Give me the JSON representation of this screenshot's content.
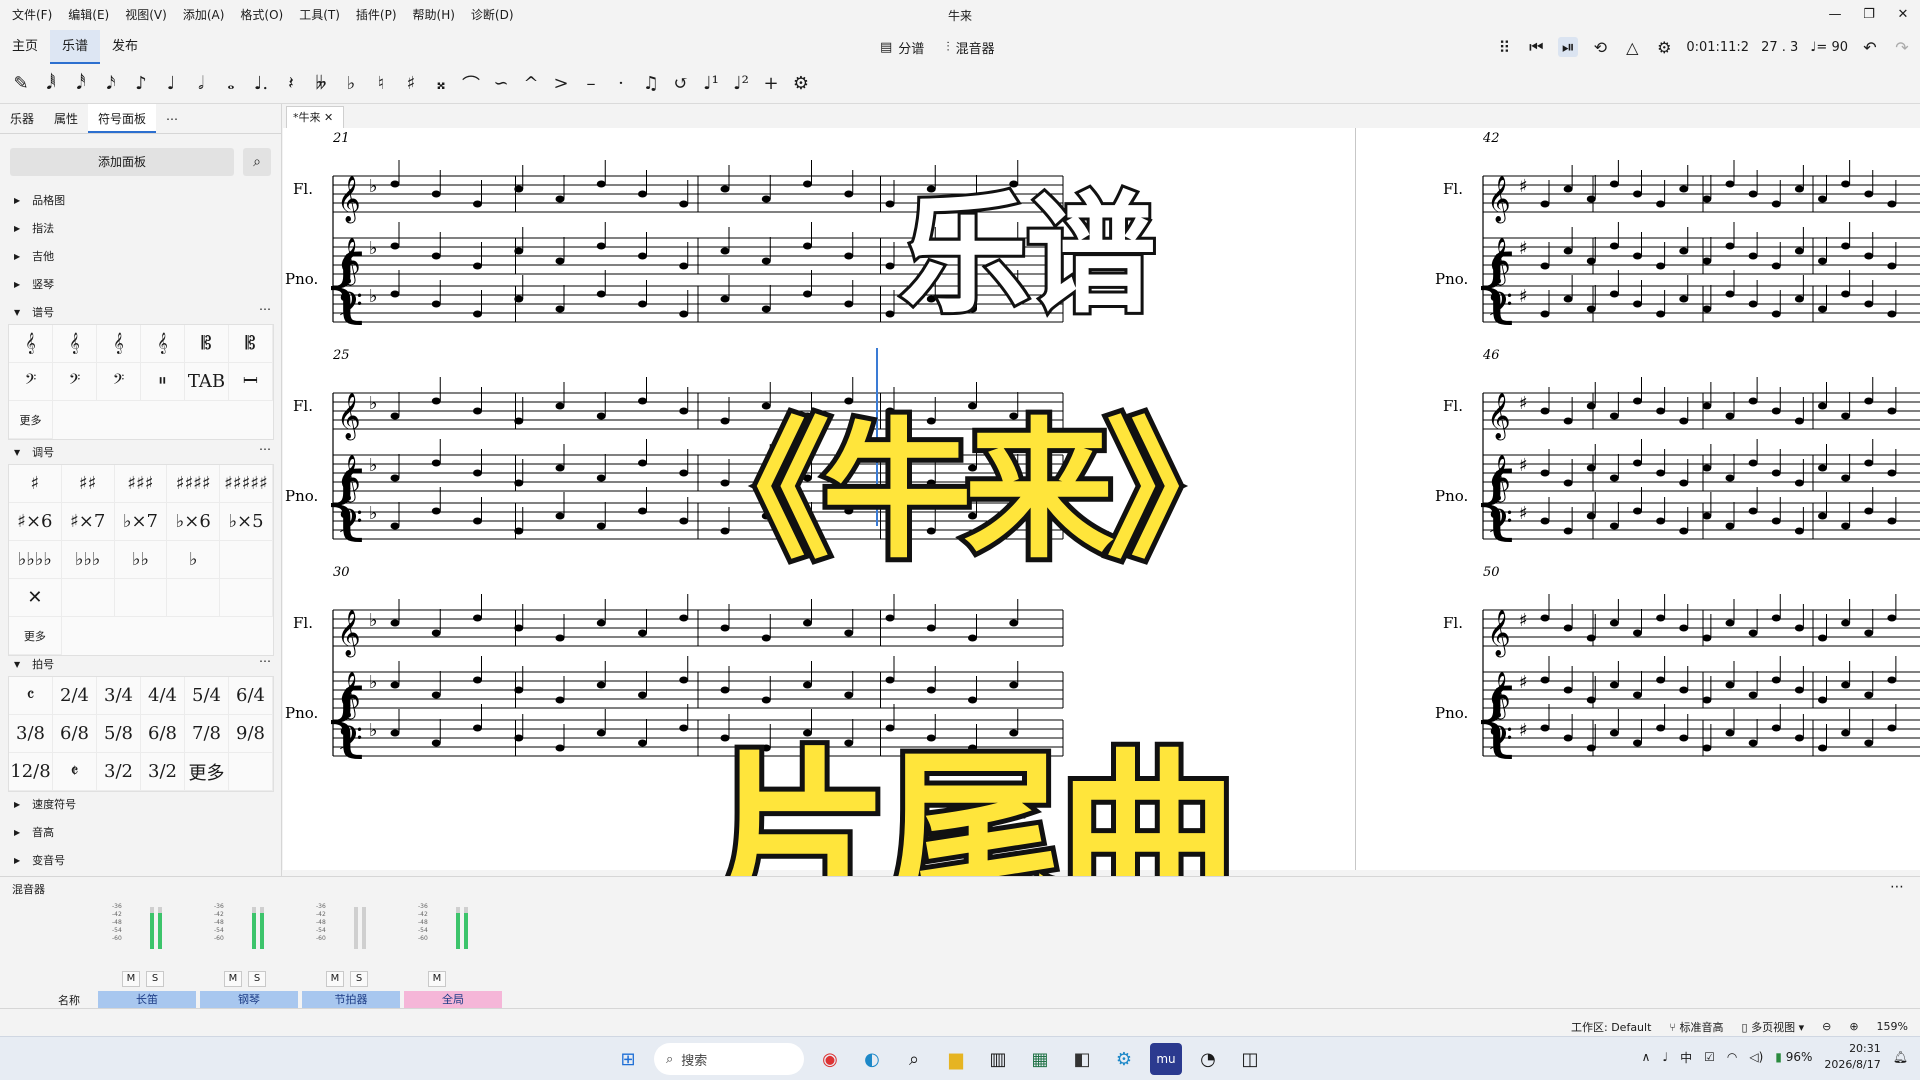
{
  "window": {
    "title": "牛来"
  },
  "menu": [
    "文件(F)",
    "编辑(E)",
    "视图(V)",
    "添加(A)",
    "格式(O)",
    "工具(T)",
    "插件(P)",
    "帮助(H)",
    "诊断(D)"
  ],
  "workspace_tabs": [
    "主页",
    "乐谱",
    "发布"
  ],
  "center": {
    "parts": "分谱",
    "mixer": "混音器"
  },
  "playback": {
    "time": "0:01:11:2",
    "position": "27 . 3",
    "tempo": "♩= 90"
  },
  "note_toolbar": [
    "✎",
    "𝅘𝅥𝅱",
    "𝅘𝅥𝅰",
    "𝅘𝅥𝅯",
    "♪",
    "♩",
    "𝅗𝅥",
    "𝅝",
    "♩.",
    "𝄽",
    "𝄫",
    "♭",
    "♮",
    "♯",
    "𝄪",
    "⌒",
    "∽",
    "^",
    ">",
    "–",
    "·",
    "♫",
    "↺",
    "♩¹",
    "♩²",
    "+",
    "⚙"
  ],
  "panel": {
    "tabs": [
      "乐器",
      "属性",
      "符号面板"
    ],
    "add_panel": "添加面板",
    "sections": [
      "品格图",
      "指法",
      "吉他",
      "竖琴"
    ],
    "clef_title": "谱号",
    "clefs": [
      "𝄞",
      "𝄞",
      "𝄞",
      "𝄞",
      "𝄡",
      "𝄡",
      "𝄢",
      "𝄢",
      "𝄢",
      "𝄥",
      "TAB",
      "𝄩"
    ],
    "clef_more": "更多",
    "key_title": "调号",
    "keys": [
      "♯",
      "♯♯",
      "♯♯♯",
      "♯♯♯♯",
      "♯♯♯♯♯",
      "♯×6",
      "♯×7",
      "♭×7",
      "♭×6",
      "♭×5",
      "♭♭♭♭",
      "♭♭♭",
      "♭♭",
      "♭",
      "",
      "✕",
      "",
      "",
      "",
      ""
    ],
    "key_more": "更多",
    "time_title": "拍号",
    "times": [
      "𝄴",
      "2/4",
      "3/4",
      "4/4",
      "5/4",
      "6/4",
      "3/8",
      "6/8",
      "5/8",
      "6/8",
      "7/8",
      "9/8",
      "12/8",
      "𝄵",
      "3/2",
      "3/2",
      "更多",
      ""
    ],
    "more_sections": [
      "速度符号",
      "音高",
      "变音号"
    ]
  },
  "score": {
    "tab_label": "*牛来",
    "instruments": [
      "Fl.",
      "Pno."
    ],
    "measure_numbers": [
      "21",
      "25",
      "30",
      "42",
      "46",
      "50"
    ]
  },
  "overlay_text": {
    "line1": "乐谱",
    "line2": "《牛来》",
    "line3": "片尾曲"
  },
  "mixer": {
    "title": "混音器",
    "name_label": "名称",
    "channels": [
      {
        "name": "长笛",
        "color": "#a8c7ef",
        "level": 0.85
      },
      {
        "name": "钢琴",
        "color": "#a8c7ef",
        "level": 0.85
      },
      {
        "name": "节拍器",
        "color": "#a8c7ef",
        "level": 0
      },
      {
        "name": "全局",
        "color": "#f5b6d8",
        "level": 0.85
      }
    ],
    "mute": "M",
    "solo": "S"
  },
  "status": {
    "workspace": "工作区: Default",
    "pitch": "标准音高",
    "view": "多页视图",
    "zoom": "159%"
  },
  "taskbar": {
    "search": "搜索",
    "clock_time": "20:31",
    "clock_date": "2026/8/17",
    "battery": "96%",
    "ime": "中"
  }
}
